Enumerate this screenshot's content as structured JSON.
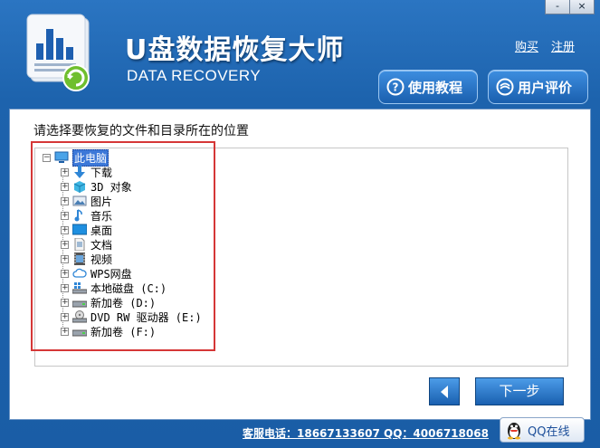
{
  "window": {
    "controls": {
      "minimize": "-",
      "close": "×"
    }
  },
  "header": {
    "title": "U盘数据恢复大师",
    "subtitle": "DATA RECOVERY",
    "links": {
      "buy": "购买",
      "register": "注册"
    },
    "buttons": {
      "tutorial": "使用教程",
      "reviews": "用户评价"
    }
  },
  "main": {
    "prompt": "请选择要恢复的文件和目录所在的位置",
    "tree": {
      "root": "此电脑",
      "items": [
        {
          "label": "下载",
          "icon": "download-folder-icon"
        },
        {
          "label": "3D 对象",
          "icon": "3d-objects-icon"
        },
        {
          "label": "图片",
          "icon": "pictures-icon"
        },
        {
          "label": "音乐",
          "icon": "music-icon"
        },
        {
          "label": "桌面",
          "icon": "desktop-icon"
        },
        {
          "label": "文档",
          "icon": "documents-icon"
        },
        {
          "label": "视频",
          "icon": "videos-icon"
        },
        {
          "label": "WPS网盘",
          "icon": "cloud-drive-icon"
        },
        {
          "label": "本地磁盘 (C:)",
          "icon": "system-drive-icon"
        },
        {
          "label": "新加卷 (D:)",
          "icon": "drive-icon"
        },
        {
          "label": "DVD RW 驱动器 (E:)",
          "icon": "dvd-drive-icon"
        },
        {
          "label": "新加卷 (F:)",
          "icon": "drive-icon"
        }
      ]
    }
  },
  "nav": {
    "next": "下一步"
  },
  "footer": {
    "contact": "客服电话：18667133607 QQ：4006718068",
    "qq_label": "QQ在线"
  },
  "colors": {
    "header_blue": "#2b75c2",
    "highlight_red": "#d53737",
    "selection_blue": "#3c78d8"
  }
}
